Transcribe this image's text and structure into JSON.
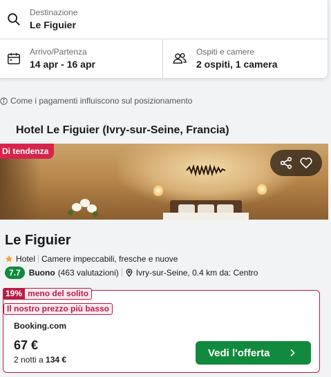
{
  "search": {
    "destination_label": "Destinazione",
    "destination_value": "Le Figuier",
    "dates_label": "Arrivo/Partenza",
    "dates_value": "14 apr - 16 apr",
    "guests_label": "Ospiti e camere",
    "guests_value": "2 ospiti, 1 camera"
  },
  "info_line": "Come i pagamenti influiscono sul posizionamento",
  "section_title": "Hotel Le Figuier (Ivry-sur-Seine, Francia)",
  "hotel": {
    "trend_badge": "Di tendenza",
    "name": "Le Figuier",
    "stars": 1,
    "type": "Hotel",
    "highlight": "Camere impeccabili, fresche e nuove",
    "score": "7.7",
    "rating_word": "Buono",
    "reviews": "(463 valutazioni)",
    "location": "Ivry-sur-Seine, 0.4 km da: Centro"
  },
  "offer": {
    "discount_pct": "19%",
    "discount_text": "meno del solito",
    "lowest_tag": "Il nostro prezzo più basso",
    "provider": "Booking.com",
    "price": "67 €",
    "nights_prefix": "2 notti a",
    "total": "134 €",
    "cta_label": "Vedi l'offerta"
  },
  "colors": {
    "accent_green": "#128a3e",
    "badge_red": "#d6244c",
    "deal_red": "#b81d47"
  },
  "icons": [
    "search-icon",
    "calendar-icon",
    "guests-icon",
    "info-icon",
    "share-icon",
    "heart-icon",
    "star-icon",
    "location-pin-icon",
    "chevron-right-icon"
  ]
}
